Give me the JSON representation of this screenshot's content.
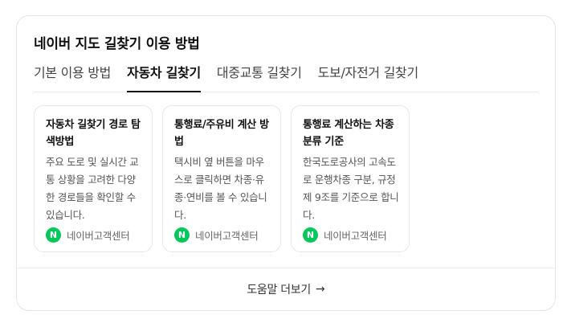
{
  "card": {
    "title": "네이버 지도 길찾기 이용 방법"
  },
  "tabs": [
    {
      "label": "기본 이용 방법",
      "active": false
    },
    {
      "label": "자동차 길찾기",
      "active": true
    },
    {
      "label": "대중교통 길찾기",
      "active": false
    },
    {
      "label": "도보/자전거 길찾기",
      "active": false
    }
  ],
  "items": [
    {
      "title": "자동차 길찾기 경로 탐색방법",
      "desc": "주요 도로 및 실시간 교통 상황을 고려한 다양한 경로들을 확인할 수 있습니다.",
      "source": "네이버고객센터",
      "source_icon": "naver-n-icon"
    },
    {
      "title": "통행료/주유비 계산 방법",
      "desc": "택시비 옆 버튼을 마우스로 클릭하면 차종·유종·연비를 볼 수 있습니다.",
      "source": "네이버고객센터",
      "source_icon": "naver-n-icon"
    },
    {
      "title": "통행료 계산하는 차종 분류 기준",
      "desc": "한국도로공사의 고속도로 운행차종 구분, 규정 제 9조를 기준으로 합니다.",
      "source": "네이버고객센터",
      "source_icon": "naver-n-icon"
    }
  ],
  "footer": {
    "label": "도움말 더보기",
    "arrow": "→"
  },
  "colors": {
    "naver_green": "#03c75a",
    "border": "#e4e4e4",
    "text_primary": "#111111"
  }
}
